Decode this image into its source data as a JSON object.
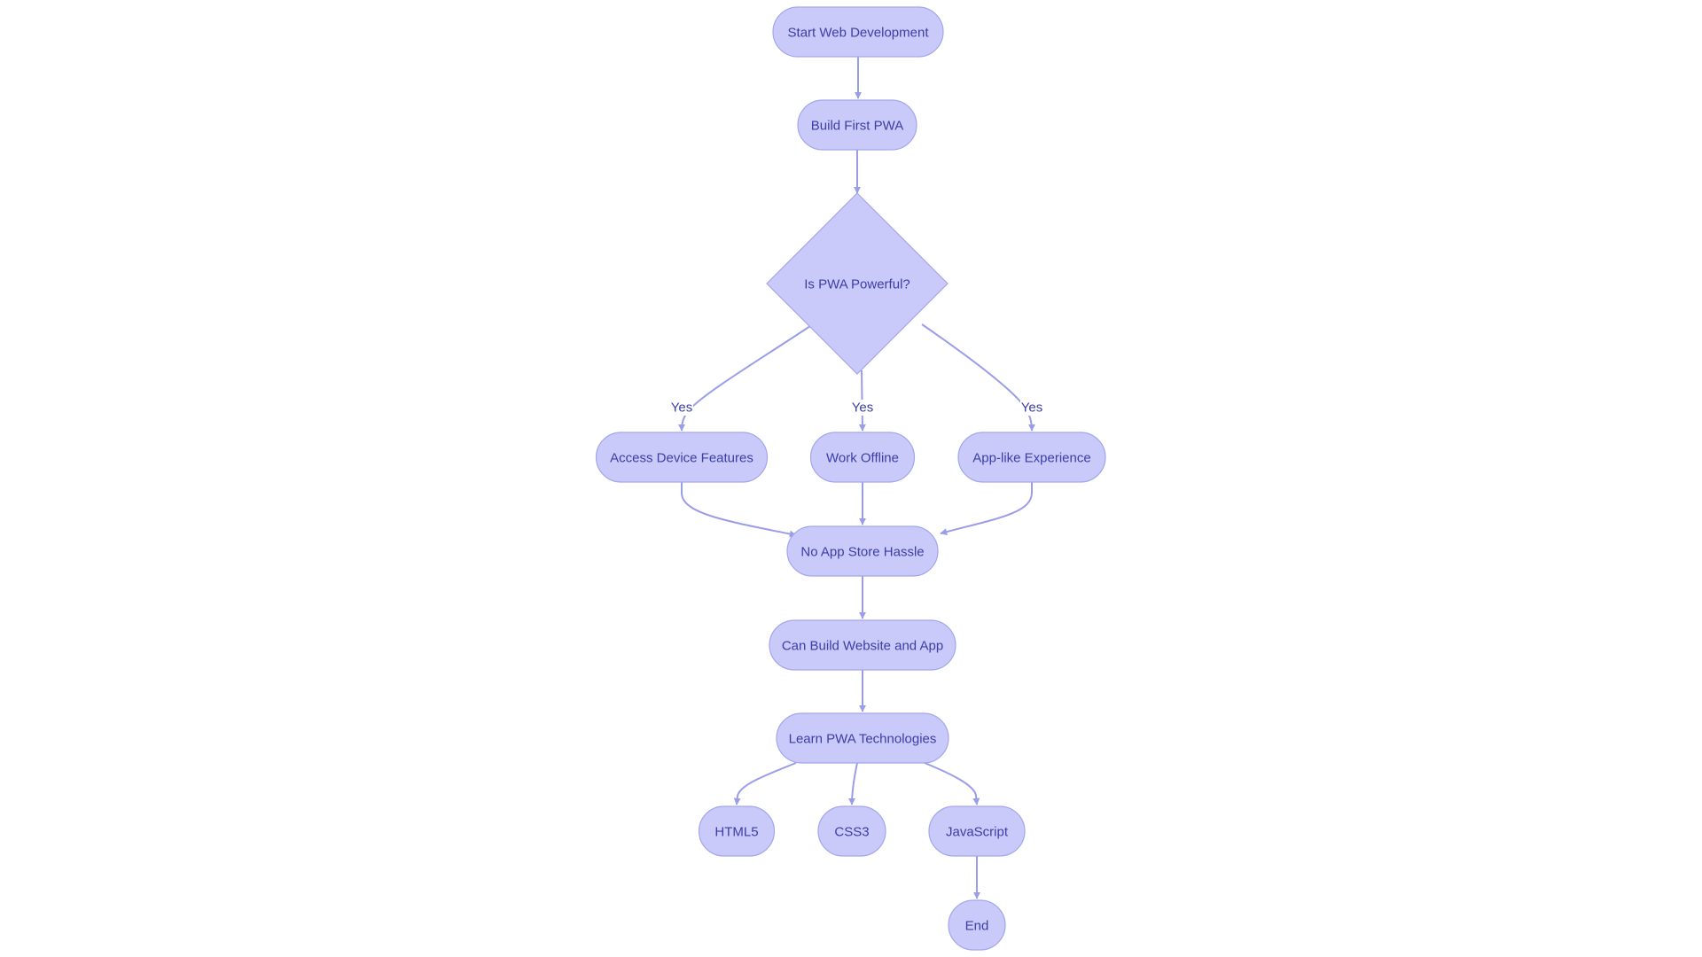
{
  "diagram": {
    "type": "flowchart",
    "direction": "top-down",
    "colors": {
      "node_fill": "#c9caf9",
      "node_stroke": "#a3a6ec",
      "edge": "#9a9de8",
      "text": "#3b3ea8",
      "background": "#ffffff"
    },
    "nodes": [
      {
        "id": "start",
        "label": "Start Web Development",
        "shape": "stadium"
      },
      {
        "id": "build",
        "label": "Build First PWA",
        "shape": "stadium"
      },
      {
        "id": "decision",
        "label": "Is PWA Powerful?",
        "shape": "diamond"
      },
      {
        "id": "access",
        "label": "Access Device Features",
        "shape": "stadium"
      },
      {
        "id": "offline",
        "label": "Work Offline",
        "shape": "stadium"
      },
      {
        "id": "applike",
        "label": "App-like Experience",
        "shape": "stadium"
      },
      {
        "id": "noappstore",
        "label": "No App Store Hassle",
        "shape": "stadium"
      },
      {
        "id": "canbuild",
        "label": "Can Build Website and App",
        "shape": "stadium"
      },
      {
        "id": "learn",
        "label": "Learn PWA Technologies",
        "shape": "stadium"
      },
      {
        "id": "html5",
        "label": "HTML5",
        "shape": "stadium"
      },
      {
        "id": "css3",
        "label": "CSS3",
        "shape": "stadium"
      },
      {
        "id": "js",
        "label": "JavaScript",
        "shape": "stadium"
      },
      {
        "id": "end",
        "label": "End",
        "shape": "stadium"
      }
    ],
    "edges": [
      {
        "from": "start",
        "to": "build",
        "label": ""
      },
      {
        "from": "build",
        "to": "decision",
        "label": ""
      },
      {
        "from": "decision",
        "to": "access",
        "label": "Yes"
      },
      {
        "from": "decision",
        "to": "offline",
        "label": "Yes"
      },
      {
        "from": "decision",
        "to": "applike",
        "label": "Yes"
      },
      {
        "from": "access",
        "to": "noappstore",
        "label": ""
      },
      {
        "from": "offline",
        "to": "noappstore",
        "label": ""
      },
      {
        "from": "applike",
        "to": "noappstore",
        "label": ""
      },
      {
        "from": "noappstore",
        "to": "canbuild",
        "label": ""
      },
      {
        "from": "canbuild",
        "to": "learn",
        "label": ""
      },
      {
        "from": "learn",
        "to": "html5",
        "label": ""
      },
      {
        "from": "learn",
        "to": "css3",
        "label": ""
      },
      {
        "from": "learn",
        "to": "js",
        "label": ""
      },
      {
        "from": "js",
        "to": "end",
        "label": ""
      }
    ]
  }
}
